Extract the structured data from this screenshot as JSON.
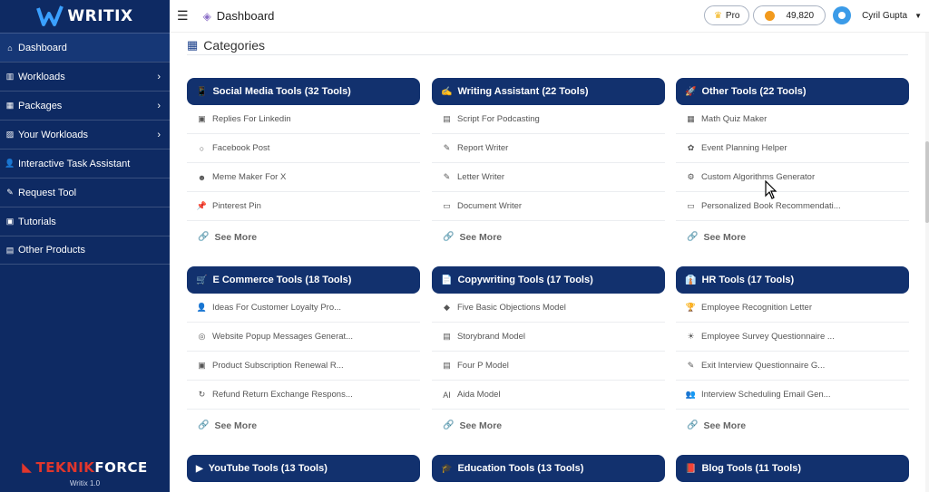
{
  "app": {
    "logo_text": "WRITIX"
  },
  "sidebar": {
    "items": [
      {
        "label": "Dashboard",
        "icon": "home-icon",
        "arrow": ""
      },
      {
        "label": "Workloads",
        "icon": "workloads-icon",
        "arrow": "›"
      },
      {
        "label": "Packages",
        "icon": "packages-icon",
        "arrow": "›"
      },
      {
        "label": "Your Workloads",
        "icon": "your-workloads-icon",
        "arrow": "›"
      },
      {
        "label": "Interactive Task Assistant",
        "icon": "assistant-icon",
        "arrow": ""
      },
      {
        "label": "Request Tool",
        "icon": "request-tool-icon",
        "arrow": ""
      },
      {
        "label": "Tutorials",
        "icon": "tutorials-icon",
        "arrow": ""
      },
      {
        "label": "Other Products",
        "icon": "other-products-icon",
        "arrow": ""
      }
    ],
    "brand_prefix": "TEKNIK",
    "brand_suffix": "FORCE",
    "version": "Writix 1.0"
  },
  "topbar": {
    "title": "Dashboard",
    "pro_label": "Pro",
    "credits": "49,820",
    "user_name": "Cyril Gupta"
  },
  "main": {
    "section_title": "Categories",
    "see_more": "See More",
    "cards": [
      {
        "title": "Social Media Tools (32 Tools)",
        "icon": "📱",
        "items": [
          {
            "label": "Replies For Linkedin",
            "icon": "▣"
          },
          {
            "label": "Facebook Post",
            "icon": "○"
          },
          {
            "label": "Meme Maker For X",
            "icon": "☻"
          },
          {
            "label": "Pinterest Pin",
            "icon": "📌"
          }
        ]
      },
      {
        "title": "Writing Assistant (22 Tools)",
        "icon": "✍",
        "items": [
          {
            "label": "Script For Podcasting",
            "icon": "▤"
          },
          {
            "label": "Report Writer",
            "icon": "✎"
          },
          {
            "label": "Letter Writer",
            "icon": "✎"
          },
          {
            "label": "Document Writer",
            "icon": "▭"
          }
        ]
      },
      {
        "title": "Other Tools (22 Tools)",
        "icon": "🚀",
        "items": [
          {
            "label": "Math Quiz Maker",
            "icon": "▦"
          },
          {
            "label": "Event Planning Helper",
            "icon": "✿"
          },
          {
            "label": "Custom Algorithms Generator",
            "icon": "⚙"
          },
          {
            "label": "Personalized Book Recommendati...",
            "icon": "▭"
          }
        ]
      },
      {
        "title": "E Commerce Tools (18 Tools)",
        "icon": "🛒",
        "items": [
          {
            "label": "Ideas For Customer Loyalty Pro...",
            "icon": "👤"
          },
          {
            "label": "Website Popup Messages Generat...",
            "icon": "◎"
          },
          {
            "label": "Product Subscription Renewal R...",
            "icon": "▣"
          },
          {
            "label": "Refund Return Exchange Respons...",
            "icon": "↻"
          }
        ]
      },
      {
        "title": "Copywriting Tools (17 Tools)",
        "icon": "📄",
        "items": [
          {
            "label": "Five Basic Objections Model",
            "icon": "◆"
          },
          {
            "label": "Storybrand Model",
            "icon": "▤"
          },
          {
            "label": "Four P Model",
            "icon": "▤"
          },
          {
            "label": "Aida Model",
            "icon": "AI"
          }
        ]
      },
      {
        "title": "HR Tools (17 Tools)",
        "icon": "👔",
        "items": [
          {
            "label": "Employee Recognition Letter",
            "icon": "🏆"
          },
          {
            "label": "Employee Survey Questionnaire ...",
            "icon": "☀"
          },
          {
            "label": "Exit Interview Questionnaire G...",
            "icon": "✎"
          },
          {
            "label": "Interview Scheduling Email Gen...",
            "icon": "👥"
          }
        ]
      },
      {
        "title": "YouTube Tools (13 Tools)",
        "icon": "▶",
        "items": []
      },
      {
        "title": "Education Tools (13 Tools)",
        "icon": "🎓",
        "items": []
      },
      {
        "title": "Blog Tools (11 Tools)",
        "icon": "📕",
        "items": []
      }
    ]
  }
}
